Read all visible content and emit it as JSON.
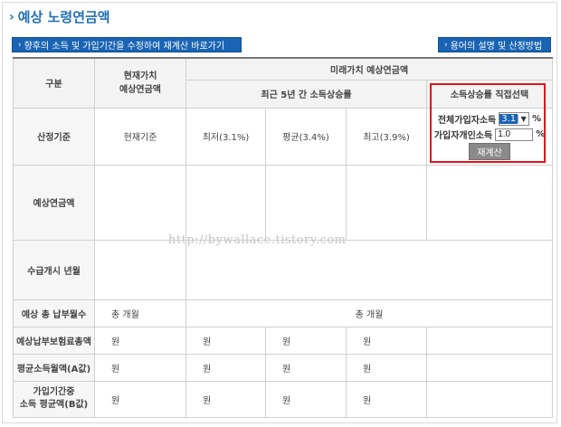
{
  "title": "예상 노령연금액",
  "buttons": {
    "left_label": "향후의 소득 및 가입기간을 수정하여 재계산 바로가기",
    "right_label": "용어의 설명 및 산정방법"
  },
  "table": {
    "header": {
      "category": "구분",
      "present_value": "현재가치\n예상연금액",
      "future_value": "미래가치 예상연금액",
      "recent5": "최근 5년 간 소득상승률",
      "direct": "소득상승률 직접선택"
    },
    "calc_basis": {
      "label": "산정기준",
      "present": "현재기준",
      "min": "최저(3.1%)",
      "avg": "평균(3.4%)",
      "max": "최고(3.9%)"
    },
    "direct_input": {
      "all_label": "전체가입자소득",
      "all_value": "3.1",
      "personal_label": "가입자개인소득",
      "personal_value": "1.0",
      "percent": "%",
      "recalc_label": "재계산"
    },
    "rows": {
      "expected_pension": "예상연금액",
      "start_age": "수급개시 년월",
      "total_months": "예상 총 납부월수",
      "insurance_total": "예상납부보험료총액",
      "avg_income": "평균소득월액(A값)",
      "member_avg": "가입기간중\n소득 평균액(B값)"
    },
    "total_months_present": "총  개월",
    "total_months_future": "총  개월",
    "won": "원"
  },
  "watermark": "http://bywallace.tistory.com"
}
